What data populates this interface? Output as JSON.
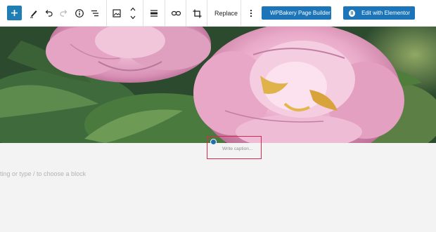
{
  "toolbar": {
    "add_icon": "plus-icon",
    "tools": [
      "pen-icon",
      "undo-icon",
      "redo-icon",
      "info-icon",
      "list-view-icon",
      "image-icon",
      "move-up-icon",
      "move-down-icon",
      "align-icon",
      "link-icon",
      "crop-icon",
      "more-vertical-icon"
    ],
    "replace_label": "Replace",
    "wpbakery_label": "WPBakery Page Builder",
    "elementor_label": "Edit with Elementor"
  },
  "image": {
    "subject": "pink-peony-flowers"
  },
  "caption": {
    "placeholder": "Write caption..."
  },
  "editor": {
    "hint": "ting or type / to choose a block"
  },
  "colors": {
    "accent": "#1f7fb5",
    "caption_border": "#d72a4d"
  }
}
